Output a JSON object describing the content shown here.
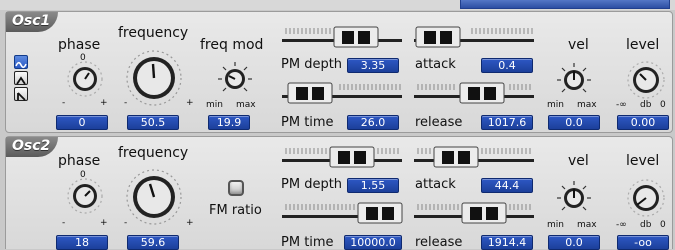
{
  "osc1": {
    "tab": "Osc1",
    "labels": {
      "phase": "phase",
      "frequency": "frequency",
      "freq_mod": "freq mod",
      "pm_depth": "PM depth",
      "pm_time": "PM time",
      "attack": "attack",
      "release": "release",
      "vel": "vel",
      "level": "level"
    },
    "values": {
      "phase": "0",
      "frequency": "50.5",
      "freq_mod": "19.9",
      "pm_depth": "3.35",
      "pm_time": "26.0",
      "attack": "0.4",
      "release": "1017.6",
      "vel": "0.0",
      "level": "0.00"
    },
    "phase_scale": {
      "top": "0",
      "minus": "-",
      "plus": "+"
    },
    "freq_scale": {
      "minus": "-",
      "plus": "+"
    },
    "freqmod_scale": {
      "min": "min",
      "max": "max"
    },
    "vel_scale": {
      "min": "min",
      "max": "max"
    },
    "level_scale": {
      "neg_inf": "-∞",
      "db": "db",
      "zero": "0"
    },
    "waveforms": [
      "sine",
      "triangle",
      "saw"
    ],
    "selected_waveform": "sine"
  },
  "osc2": {
    "tab": "Osc2",
    "labels": {
      "phase": "phase",
      "frequency": "frequency",
      "fm_ratio": "FM ratio",
      "pm_depth": "PM depth",
      "pm_time": "PM time",
      "attack": "attack",
      "release": "release",
      "vel": "vel",
      "level": "level"
    },
    "values": {
      "phase": "18",
      "frequency": "59.6",
      "pm_depth": "1.55",
      "pm_time": "10000.0",
      "attack": "44.4",
      "release": "1914.4",
      "vel": "0.0",
      "level": "-oo"
    },
    "phase_scale": {
      "top": "0",
      "minus": "-",
      "plus": "+"
    },
    "freq_scale": {
      "minus": "-",
      "plus": "+"
    },
    "vel_scale": {
      "min": "min",
      "max": "max"
    },
    "level_scale": {
      "neg_inf": "-∞",
      "db": "db",
      "zero": "0"
    }
  },
  "colors": {
    "value_box": "#2a52b8",
    "panel": "#e2e2e2",
    "tab": "#6e6e6e"
  }
}
